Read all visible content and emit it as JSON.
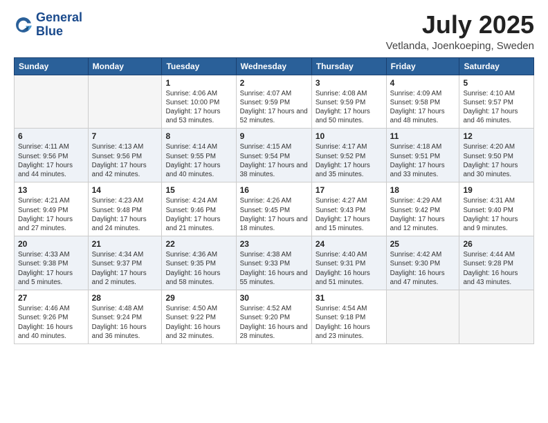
{
  "logo": {
    "line1": "General",
    "line2": "Blue"
  },
  "title": "July 2025",
  "location": "Vetlanda, Joenkoeping, Sweden",
  "days_of_week": [
    "Sunday",
    "Monday",
    "Tuesday",
    "Wednesday",
    "Thursday",
    "Friday",
    "Saturday"
  ],
  "weeks": [
    [
      {
        "day": "",
        "detail": ""
      },
      {
        "day": "",
        "detail": ""
      },
      {
        "day": "1",
        "detail": "Sunrise: 4:06 AM\nSunset: 10:00 PM\nDaylight: 17 hours\nand 53 minutes."
      },
      {
        "day": "2",
        "detail": "Sunrise: 4:07 AM\nSunset: 9:59 PM\nDaylight: 17 hours\nand 52 minutes."
      },
      {
        "day": "3",
        "detail": "Sunrise: 4:08 AM\nSunset: 9:59 PM\nDaylight: 17 hours\nand 50 minutes."
      },
      {
        "day": "4",
        "detail": "Sunrise: 4:09 AM\nSunset: 9:58 PM\nDaylight: 17 hours\nand 48 minutes."
      },
      {
        "day": "5",
        "detail": "Sunrise: 4:10 AM\nSunset: 9:57 PM\nDaylight: 17 hours\nand 46 minutes."
      }
    ],
    [
      {
        "day": "6",
        "detail": "Sunrise: 4:11 AM\nSunset: 9:56 PM\nDaylight: 17 hours\nand 44 minutes."
      },
      {
        "day": "7",
        "detail": "Sunrise: 4:13 AM\nSunset: 9:56 PM\nDaylight: 17 hours\nand 42 minutes."
      },
      {
        "day": "8",
        "detail": "Sunrise: 4:14 AM\nSunset: 9:55 PM\nDaylight: 17 hours\nand 40 minutes."
      },
      {
        "day": "9",
        "detail": "Sunrise: 4:15 AM\nSunset: 9:54 PM\nDaylight: 17 hours\nand 38 minutes."
      },
      {
        "day": "10",
        "detail": "Sunrise: 4:17 AM\nSunset: 9:52 PM\nDaylight: 17 hours\nand 35 minutes."
      },
      {
        "day": "11",
        "detail": "Sunrise: 4:18 AM\nSunset: 9:51 PM\nDaylight: 17 hours\nand 33 minutes."
      },
      {
        "day": "12",
        "detail": "Sunrise: 4:20 AM\nSunset: 9:50 PM\nDaylight: 17 hours\nand 30 minutes."
      }
    ],
    [
      {
        "day": "13",
        "detail": "Sunrise: 4:21 AM\nSunset: 9:49 PM\nDaylight: 17 hours\nand 27 minutes."
      },
      {
        "day": "14",
        "detail": "Sunrise: 4:23 AM\nSunset: 9:48 PM\nDaylight: 17 hours\nand 24 minutes."
      },
      {
        "day": "15",
        "detail": "Sunrise: 4:24 AM\nSunset: 9:46 PM\nDaylight: 17 hours\nand 21 minutes."
      },
      {
        "day": "16",
        "detail": "Sunrise: 4:26 AM\nSunset: 9:45 PM\nDaylight: 17 hours\nand 18 minutes."
      },
      {
        "day": "17",
        "detail": "Sunrise: 4:27 AM\nSunset: 9:43 PM\nDaylight: 17 hours\nand 15 minutes."
      },
      {
        "day": "18",
        "detail": "Sunrise: 4:29 AM\nSunset: 9:42 PM\nDaylight: 17 hours\nand 12 minutes."
      },
      {
        "day": "19",
        "detail": "Sunrise: 4:31 AM\nSunset: 9:40 PM\nDaylight: 17 hours\nand 9 minutes."
      }
    ],
    [
      {
        "day": "20",
        "detail": "Sunrise: 4:33 AM\nSunset: 9:38 PM\nDaylight: 17 hours\nand 5 minutes."
      },
      {
        "day": "21",
        "detail": "Sunrise: 4:34 AM\nSunset: 9:37 PM\nDaylight: 17 hours\nand 2 minutes."
      },
      {
        "day": "22",
        "detail": "Sunrise: 4:36 AM\nSunset: 9:35 PM\nDaylight: 16 hours\nand 58 minutes."
      },
      {
        "day": "23",
        "detail": "Sunrise: 4:38 AM\nSunset: 9:33 PM\nDaylight: 16 hours\nand 55 minutes."
      },
      {
        "day": "24",
        "detail": "Sunrise: 4:40 AM\nSunset: 9:31 PM\nDaylight: 16 hours\nand 51 minutes."
      },
      {
        "day": "25",
        "detail": "Sunrise: 4:42 AM\nSunset: 9:30 PM\nDaylight: 16 hours\nand 47 minutes."
      },
      {
        "day": "26",
        "detail": "Sunrise: 4:44 AM\nSunset: 9:28 PM\nDaylight: 16 hours\nand 43 minutes."
      }
    ],
    [
      {
        "day": "27",
        "detail": "Sunrise: 4:46 AM\nSunset: 9:26 PM\nDaylight: 16 hours\nand 40 minutes."
      },
      {
        "day": "28",
        "detail": "Sunrise: 4:48 AM\nSunset: 9:24 PM\nDaylight: 16 hours\nand 36 minutes."
      },
      {
        "day": "29",
        "detail": "Sunrise: 4:50 AM\nSunset: 9:22 PM\nDaylight: 16 hours\nand 32 minutes."
      },
      {
        "day": "30",
        "detail": "Sunrise: 4:52 AM\nSunset: 9:20 PM\nDaylight: 16 hours\nand 28 minutes."
      },
      {
        "day": "31",
        "detail": "Sunrise: 4:54 AM\nSunset: 9:18 PM\nDaylight: 16 hours\nand 23 minutes."
      },
      {
        "day": "",
        "detail": ""
      },
      {
        "day": "",
        "detail": ""
      }
    ]
  ]
}
